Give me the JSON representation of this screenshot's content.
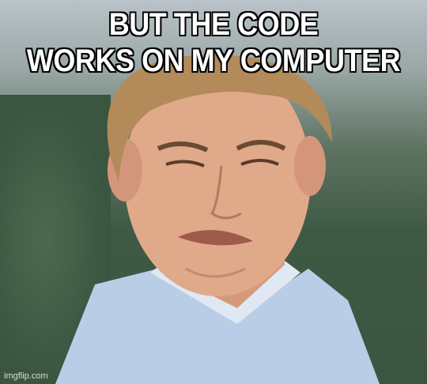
{
  "caption": {
    "top_line_1": "BUT THE CODE",
    "top_line_2": "WORKS ON MY COMPUTER"
  },
  "watermark": "imgflip.com"
}
